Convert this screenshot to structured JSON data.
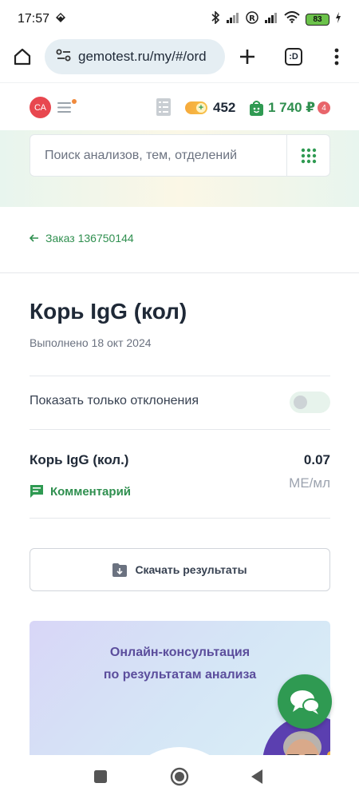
{
  "status_bar": {
    "time": "17:57",
    "battery": "83"
  },
  "browser": {
    "url": "gemotest.ru/my/#/ord",
    "tab_label": ":D"
  },
  "header": {
    "avatar_initials": "СА",
    "points": "452",
    "cart_total": "1 740 ₽",
    "cart_count": "4"
  },
  "search": {
    "placeholder": "Поиск анализов, тем, отделений"
  },
  "back_link": {
    "label": "Заказ 136750144"
  },
  "test": {
    "title": "Корь IgG (кол)",
    "completed": "Выполнено 18 окт 2024"
  },
  "filter": {
    "label": "Показать только отклонения",
    "enabled": false
  },
  "result": {
    "name": "Корь IgG (кол.)",
    "value": "0.07",
    "unit": "МЕ/мл",
    "comment_label": "Комментарий"
  },
  "download": {
    "label": "Скачать результаты"
  },
  "promo": {
    "line1": "Онлайн-консультация",
    "line2": "по результатам анализа"
  },
  "colors": {
    "accent": "#2f8f4f",
    "avatar": "#e8474f",
    "promo_text": "#5b4d9c"
  }
}
